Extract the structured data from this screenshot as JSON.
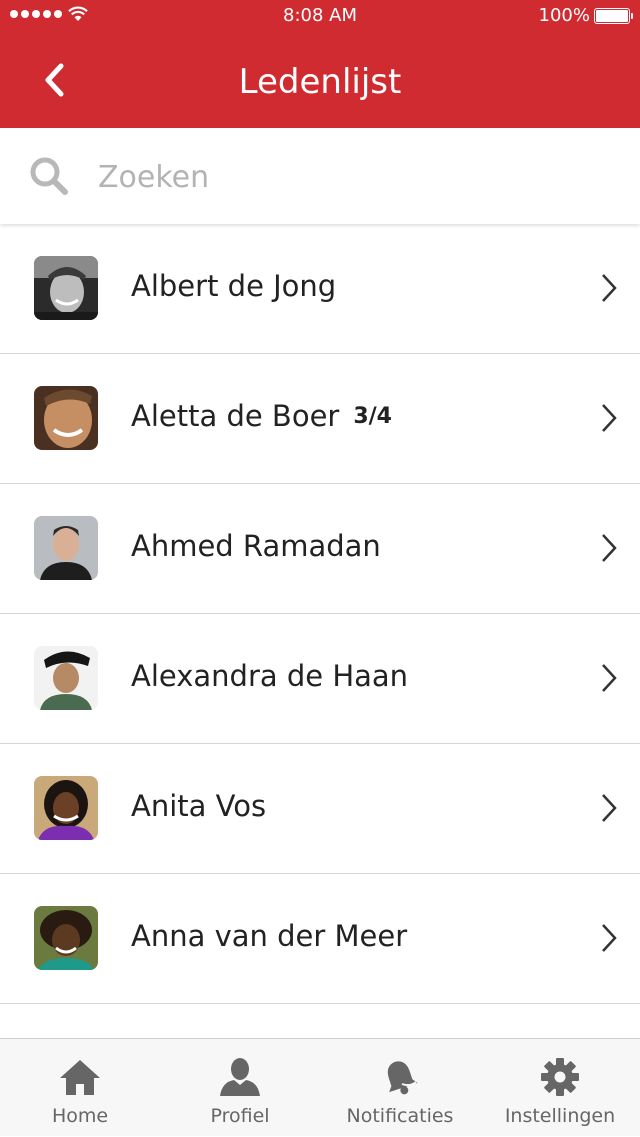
{
  "status_bar": {
    "time": "8:08 AM",
    "battery": "100%",
    "battery_level": 1.0
  },
  "header": {
    "title": "Ledenlijst",
    "back_icon": "chevron-left-icon"
  },
  "search": {
    "placeholder": "Zoeken",
    "value": "",
    "icon": "search-icon"
  },
  "members": [
    {
      "name": "Albert de Jong",
      "badge": ""
    },
    {
      "name": "Aletta de Boer",
      "badge": "3/4"
    },
    {
      "name": "Ahmed Ramadan",
      "badge": ""
    },
    {
      "name": "Alexandra de Haan",
      "badge": ""
    },
    {
      "name": "Anita Vos",
      "badge": ""
    },
    {
      "name": "Anna van der Meer",
      "badge": ""
    }
  ],
  "tabs": [
    {
      "label": "Home",
      "icon": "home-icon"
    },
    {
      "label": "Profiel",
      "icon": "user-icon"
    },
    {
      "label": "Notificaties",
      "icon": "bell-icon"
    },
    {
      "label": "Instellingen",
      "icon": "gear-icon"
    }
  ],
  "colors": {
    "brand": "#cf2b31",
    "tab_icon": "#666666",
    "divider": "#d6d6d6"
  }
}
